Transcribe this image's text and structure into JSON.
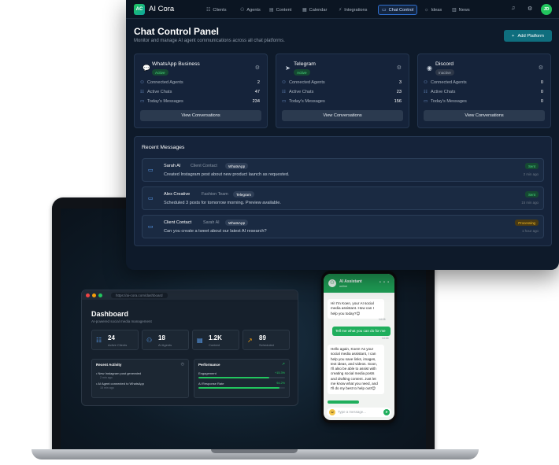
{
  "panel": {
    "brand": {
      "logo": "AC",
      "name": "AI Cora"
    },
    "nav": [
      {
        "label": "Clients",
        "icon": "users-icon",
        "glyph": "☷"
      },
      {
        "label": "Agents",
        "icon": "bot-icon",
        "glyph": "⚇"
      },
      {
        "label": "Content",
        "icon": "file-icon",
        "glyph": "▤"
      },
      {
        "label": "Calendar",
        "icon": "calendar-icon",
        "glyph": "▦"
      },
      {
        "label": "Integrations",
        "icon": "plug-icon",
        "glyph": "⚡"
      },
      {
        "label": "Chat Control",
        "icon": "chat-icon",
        "glyph": "▭",
        "active": true
      },
      {
        "label": "Ideas",
        "icon": "lightbulb-icon",
        "glyph": "☼"
      },
      {
        "label": "News",
        "icon": "newspaper-icon",
        "glyph": "▥"
      }
    ],
    "user_initials": "JD",
    "title": "Chat Control Panel",
    "subtitle": "Monitor and manage AI agent communications across all chat platforms.",
    "add_button": "Add Platform",
    "platforms": [
      {
        "name": "WhatsApp Business",
        "status": "Active",
        "icon": "whatsapp-icon",
        "glyph": "💬",
        "rows": [
          {
            "label": "Connected Agents",
            "value": "2"
          },
          {
            "label": "Active Chats",
            "value": "47"
          },
          {
            "label": "Today's Messages",
            "value": "234"
          }
        ],
        "button": "View Conversations"
      },
      {
        "name": "Telegram",
        "status": "Active",
        "icon": "telegram-icon",
        "glyph": "➤",
        "rows": [
          {
            "label": "Connected Agents",
            "value": "3"
          },
          {
            "label": "Active Chats",
            "value": "23"
          },
          {
            "label": "Today's Messages",
            "value": "156"
          }
        ],
        "button": "View Conversations"
      },
      {
        "name": "Discord",
        "status": "Inactive",
        "icon": "discord-icon",
        "glyph": "◉",
        "rows": [
          {
            "label": "Connected Agents",
            "value": "0"
          },
          {
            "label": "Active Chats",
            "value": "0"
          },
          {
            "label": "Today's Messages",
            "value": "0"
          }
        ],
        "button": "View Conversations"
      }
    ],
    "recent_title": "Recent Messages",
    "messages": [
      {
        "from": "Sarah AI",
        "role": "Client Contact",
        "platform": "WhatsApp",
        "text": "Created Instagram post about new product launch as requested.",
        "status": "Sent",
        "time": "2 min ago"
      },
      {
        "from": "Alex Creative",
        "role": "Fashion Team",
        "platform": "Telegram",
        "text": "Scheduled 3 posts for tomorrow morning. Preview available.",
        "status": "Sent",
        "time": "15 min ago"
      },
      {
        "from": "Client Contact",
        "role": "Sarah AI",
        "platform": "WhatsApp",
        "text": "Can you create a tweet about our latest AI research?",
        "status": "Processing",
        "time": "1 hour ago"
      }
    ]
  },
  "dashboard": {
    "url": "https://ai-cora.com/dashboard",
    "title": "Dashboard",
    "subtitle": "AI-powered social media management",
    "stats": [
      {
        "value": "24",
        "label": "Active Clients",
        "icon": "users-icon",
        "glyph": "☷"
      },
      {
        "value": "18",
        "label": "AI Agents",
        "icon": "bot-icon",
        "glyph": "⚇"
      },
      {
        "value": "1.2K",
        "label": "Content",
        "icon": "file-icon",
        "glyph": "▤"
      },
      {
        "value": "89",
        "label": "Scheduled",
        "icon": "trend-icon",
        "glyph": "↗"
      }
    ],
    "activity": {
      "title": "Recent Activity",
      "items": [
        {
          "text": "New Instagram post generated",
          "time": "2 min ago"
        },
        {
          "text": "AI Agent connected to WhatsApp",
          "time": "15 min ago"
        }
      ]
    },
    "performance": {
      "title": "Performance",
      "metrics": [
        {
          "label": "Engagement",
          "value": "+15.3%",
          "fill": 0.82
        },
        {
          "label": "AI Response Rate",
          "value": "94.2%",
          "fill": 0.94
        }
      ]
    }
  },
  "phone": {
    "contact": "AI Assistant",
    "status": "online",
    "messages": [
      {
        "dir": "in",
        "text": "Hi! I'm Koen, your AI social media assistant. How can I help you today?😊",
        "time": "14:16"
      },
      {
        "dir": "out",
        "text": "Tell me what you can do for me",
        "time": "14:16"
      },
      {
        "dir": "in",
        "text": "Hello again, Koen! As your social media assistant, I can help you save links, images, text ideas, and videos. Soon, I'll also be able to assist with creating social media posts and drafting content. Just let me know what you need, and I'll do my best to help out!😊",
        "time": "14:16"
      }
    ],
    "input_placeholder": "Type a message..."
  },
  "colors": {
    "accent": "#22c55e",
    "panel_bg": "#0e1a2a",
    "brand_button": "#0f6e7e",
    "whatsapp": "#1fae5c"
  }
}
